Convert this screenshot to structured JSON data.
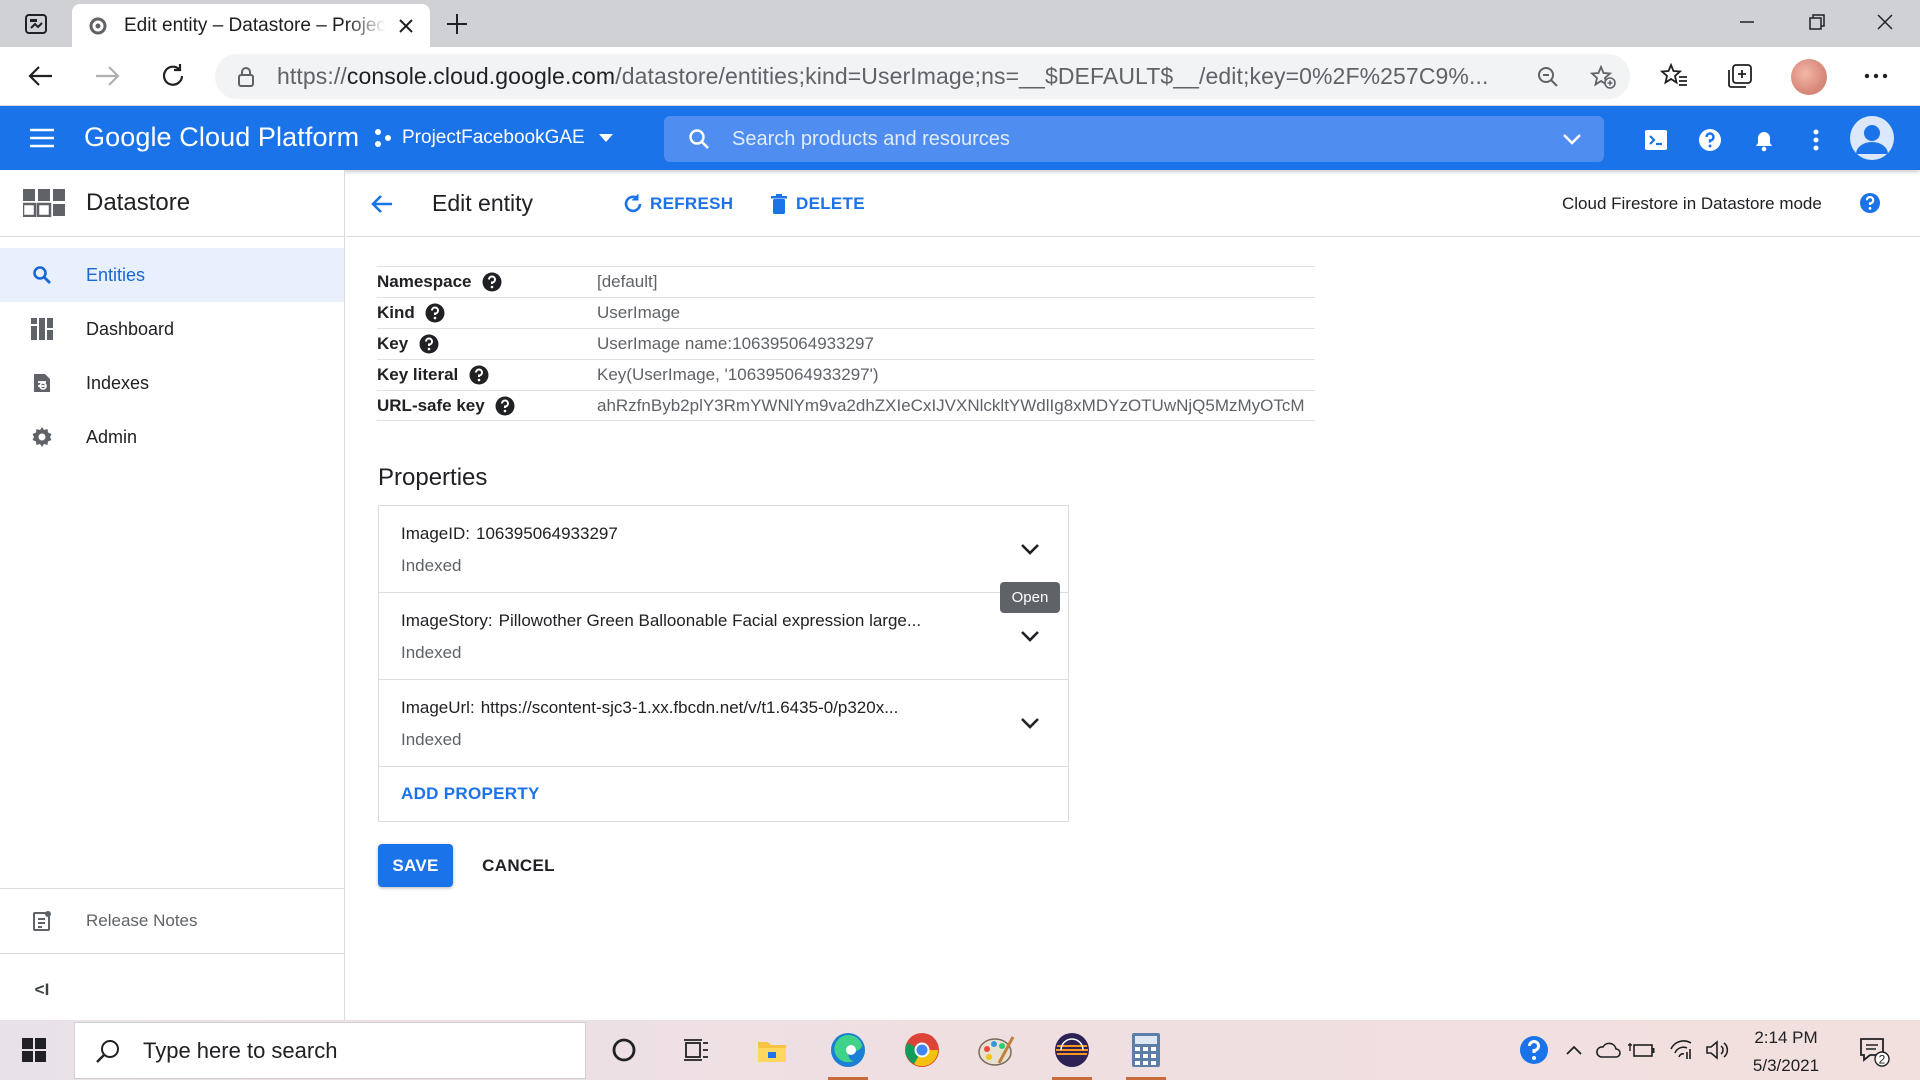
{
  "browser": {
    "tab_title": "Edit entity – Datastore – ProjectF",
    "url_scheme": "https://",
    "url_host": "console.cloud.google.com",
    "url_path": "/datastore/entities;kind=UserImage;ns=__$DEFAULT$__/edit;key=0%2F%257C9%..."
  },
  "gcp": {
    "brand": "Google Cloud Platform",
    "project": "ProjectFacebookGAE",
    "search_placeholder": "Search products and resources",
    "accent": "#1a73e8"
  },
  "sidebar": {
    "product": "Datastore",
    "items": [
      {
        "label": "Entities",
        "icon": "search-icon",
        "active": true
      },
      {
        "label": "Dashboard",
        "icon": "dashboard-icon",
        "active": false
      },
      {
        "label": "Indexes",
        "icon": "indexes-icon",
        "active": false
      },
      {
        "label": "Admin",
        "icon": "gear-icon",
        "active": false
      }
    ],
    "release_notes": "Release Notes",
    "collapse": "<I"
  },
  "toolbar": {
    "title": "Edit entity",
    "refresh": "REFRESH",
    "delete": "DELETE",
    "mode": "Cloud Firestore in Datastore mode"
  },
  "entity": {
    "rows": [
      {
        "key": "Namespace",
        "value": "[default]"
      },
      {
        "key": "Kind",
        "value": "UserImage"
      },
      {
        "key": "Key",
        "value": "UserImage name:106395064933297"
      },
      {
        "key": "Key literal",
        "value": "Key(UserImage, '106395064933297')"
      },
      {
        "key": "URL-safe key",
        "value": "ahRzfnByb2plY3RmYWNlYm9va2dhZXIeCxIJVXNlckltYWdlIg8xMDYzOTUwNjQ5MzMyOTcM"
      }
    ]
  },
  "properties": {
    "heading": "Properties",
    "items": [
      {
        "name": "ImageID:",
        "value": "106395064933297",
        "indexed": "Indexed"
      },
      {
        "name": "ImageStory:",
        "value": "Pillowother Green Balloonable Facial expression large...",
        "indexed": "Indexed"
      },
      {
        "name": "ImageUrl:",
        "value": "https://scontent-sjc3-1.xx.fbcdn.net/v/t1.6435-0/p320x...",
        "indexed": "Indexed"
      }
    ],
    "add": "ADD PROPERTY",
    "tooltip": "Open"
  },
  "actions": {
    "save": "SAVE",
    "cancel": "CANCEL"
  },
  "taskbar": {
    "search_placeholder": "Type here to search",
    "time": "2:14 PM",
    "date": "5/3/2021",
    "notification_count": "2"
  }
}
